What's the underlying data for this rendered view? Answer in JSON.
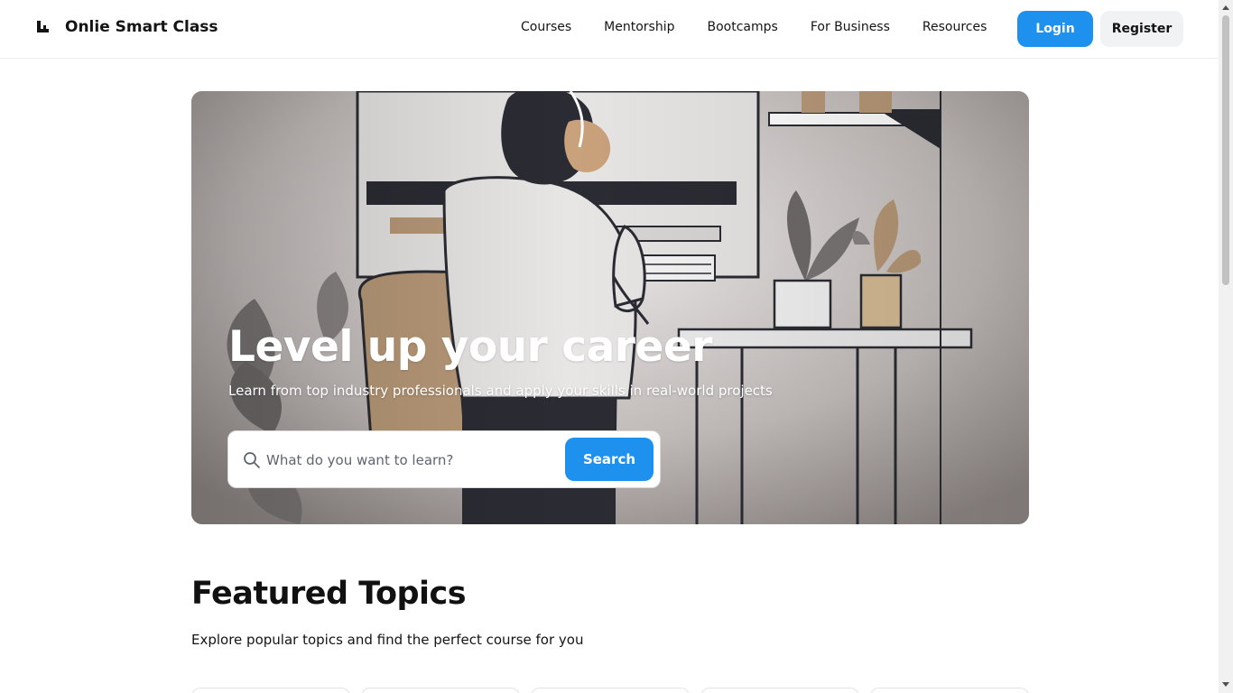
{
  "header": {
    "logo_text": "Onlie Smart Class",
    "nav": [
      "Courses",
      "Mentorship",
      "Bootcamps",
      "For Business",
      "Resources"
    ],
    "login_label": "Login",
    "register_label": "Register"
  },
  "hero": {
    "title": "Level up your career",
    "subtitle": "Learn from top industry professionals and apply your skills in real-world projects",
    "search": {
      "placeholder": "What do you want to learn?",
      "value": "",
      "button_label": "Search"
    }
  },
  "featured": {
    "title": "Featured Topics",
    "subtitle": "Explore popular topics and find the perfect course for you"
  },
  "colors": {
    "accent": "#1e90ee",
    "secondary_button": "#f0f2f4",
    "text": "#111111"
  },
  "icons": [
    "logo-icon",
    "search-icon"
  ]
}
